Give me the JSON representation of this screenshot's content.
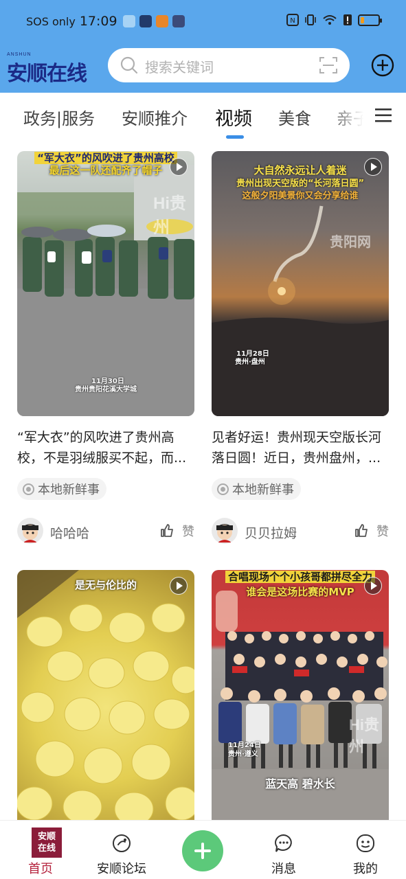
{
  "status_bar": {
    "carrier": "SOS only",
    "time": "17:09",
    "battery_level": 0.2
  },
  "header": {
    "logo_small": "ANSHUN",
    "logo_text": "安顺在线",
    "search_placeholder": "搜索关键词"
  },
  "tabs": [
    {
      "label": "政务|服务",
      "active": false
    },
    {
      "label": "安顺推介",
      "active": false
    },
    {
      "label": "视频",
      "active": true
    },
    {
      "label": "美食",
      "active": false
    },
    {
      "label": "亲子",
      "active": false
    }
  ],
  "colors": {
    "header_bg": "#5aa7ec",
    "tab_indicator": "#3a8ee6",
    "home_active": "#b4213c",
    "fab": "#5cc97a"
  },
  "feed": [
    {
      "caption_line1": "“军大衣”的风吹进了贵州高校",
      "caption_line2": "最后这一队还配齐了帽子",
      "overlay_date": "11月30日",
      "overlay_place": "贵州贵阳花溪大学城",
      "watermark": "Hi贵州",
      "title": "“军大衣”的风吹进了贵州高校，不是羽绒服买不起，而...",
      "tag": "本地新鲜事",
      "author": "哈哈哈",
      "like_label": "赞"
    },
    {
      "caption_line1": "大自然永远让人着迷",
      "caption_line2": "贵州出现天空版的“长河落日圆”",
      "caption_line3": "这般夕阳美景你又会分享给谁",
      "overlay_date": "11月28日",
      "overlay_place": "贵州·盘州",
      "watermark": "贵阳网",
      "title": "见者好运！贵州现天空版长河落日圆！近日，贵州盘州，...",
      "tag": "本地新鲜事",
      "author": "贝贝拉姆",
      "like_label": "赞"
    },
    {
      "caption_line1": "是无与伦比的"
    },
    {
      "caption_line1": "合唱现场个个小孩哥都拼尽全力",
      "caption_line2": "谁会是这场比赛的MVP",
      "overlay_date": "11月24日",
      "overlay_place": "贵州·遵义",
      "bottom_caption": "蓝天高 碧水长",
      "watermark": "Hi贵州"
    }
  ],
  "bottom_nav": [
    {
      "label": "首页",
      "active": true,
      "logo_text": "安顺在线"
    },
    {
      "label": "安顺论坛",
      "active": false
    },
    {
      "label": "",
      "active": false
    },
    {
      "label": "消息",
      "active": false
    },
    {
      "label": "我的",
      "active": false
    }
  ]
}
